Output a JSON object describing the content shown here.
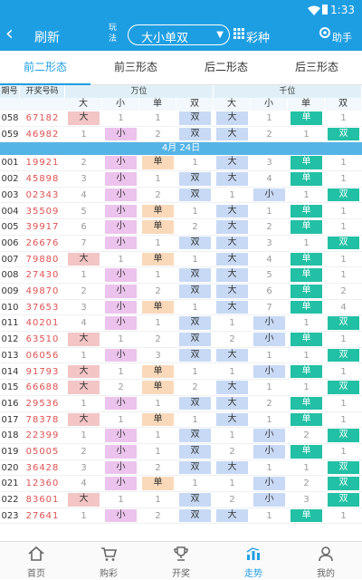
{
  "status_bar": {
    "time": "1:33"
  },
  "header": {
    "refresh_label": "刷新",
    "play_label": "玩法",
    "play_value": "大小单双",
    "lottery_label": "彩种",
    "help_label": "助手"
  },
  "tabs": [
    {
      "label": "前二形态",
      "active": true
    },
    {
      "label": "前三形态",
      "active": false
    },
    {
      "label": "后二形态",
      "active": false
    },
    {
      "label": "后三形态",
      "active": false
    }
  ],
  "table": {
    "col_issue": "期号",
    "col_number": "开奖号码",
    "group1": "万位",
    "group2": "千位",
    "subheaders": [
      "大",
      "小",
      "单",
      "双",
      "大",
      "小",
      "单",
      "双"
    ],
    "date_label": "4月 24日",
    "pre_rows": [
      {
        "issue": "058",
        "number": "67182",
        "cells": [
          "大",
          "1",
          "1",
          "双",
          "大",
          "1",
          "单",
          "1"
        ]
      },
      {
        "issue": "059",
        "number": "46982",
        "cells": [
          "1",
          "小",
          "2",
          "双",
          "大",
          "2",
          "1",
          "双"
        ]
      }
    ],
    "rows": [
      {
        "issue": "001",
        "number": "19921",
        "cells": [
          "2",
          "小",
          "单",
          "1",
          "大",
          "3",
          "单",
          "1"
        ]
      },
      {
        "issue": "002",
        "number": "45898",
        "cells": [
          "3",
          "小",
          "1",
          "双",
          "大",
          "4",
          "单",
          "1"
        ]
      },
      {
        "issue": "003",
        "number": "02343",
        "cells": [
          "4",
          "小",
          "2",
          "双",
          "1",
          "小",
          "1",
          "双"
        ]
      },
      {
        "issue": "004",
        "number": "35509",
        "cells": [
          "5",
          "小",
          "单",
          "1",
          "大",
          "1",
          "单",
          "1"
        ]
      },
      {
        "issue": "005",
        "number": "39917",
        "cells": [
          "6",
          "小",
          "单",
          "2",
          "大",
          "2",
          "单",
          "1"
        ]
      },
      {
        "issue": "006",
        "number": "26676",
        "cells": [
          "7",
          "小",
          "1",
          "双",
          "大",
          "3",
          "1",
          "双"
        ]
      },
      {
        "issue": "007",
        "number": "79880",
        "cells": [
          "大",
          "1",
          "单",
          "1",
          "大",
          "4",
          "单",
          "1"
        ]
      },
      {
        "issue": "008",
        "number": "27430",
        "cells": [
          "1",
          "小",
          "1",
          "双",
          "大",
          "5",
          "单",
          "1"
        ]
      },
      {
        "issue": "009",
        "number": "49870",
        "cells": [
          "2",
          "小",
          "2",
          "双",
          "大",
          "6",
          "单",
          "2"
        ]
      },
      {
        "issue": "010",
        "number": "37653",
        "cells": [
          "3",
          "小",
          "单",
          "1",
          "大",
          "7",
          "单",
          "4"
        ]
      },
      {
        "issue": "011",
        "number": "40201",
        "cells": [
          "4",
          "小",
          "1",
          "双",
          "1",
          "小",
          "1",
          "双"
        ]
      },
      {
        "issue": "012",
        "number": "63510",
        "cells": [
          "大",
          "1",
          "2",
          "双",
          "2",
          "小",
          "单",
          "1"
        ]
      },
      {
        "issue": "013",
        "number": "06056",
        "cells": [
          "1",
          "小",
          "3",
          "双",
          "大",
          "1",
          "1",
          "双"
        ]
      },
      {
        "issue": "014",
        "number": "91793",
        "cells": [
          "大",
          "1",
          "单",
          "1",
          "1",
          "小",
          "单",
          "1"
        ]
      },
      {
        "issue": "015",
        "number": "66688",
        "cells": [
          "大",
          "2",
          "单",
          "2",
          "大",
          "1",
          "1",
          "双"
        ]
      },
      {
        "issue": "016",
        "number": "29536",
        "cells": [
          "1",
          "小",
          "1",
          "双",
          "大",
          "2",
          "单",
          "1"
        ]
      },
      {
        "issue": "017",
        "number": "78378",
        "cells": [
          "大",
          "1",
          "单",
          "1",
          "大",
          "1",
          "单",
          "1"
        ]
      },
      {
        "issue": "018",
        "number": "22399",
        "cells": [
          "1",
          "小",
          "1",
          "双",
          "1",
          "小",
          "2",
          "双"
        ]
      },
      {
        "issue": "019",
        "number": "05005",
        "cells": [
          "2",
          "小",
          "1",
          "双",
          "2",
          "小",
          "单",
          "1"
        ]
      },
      {
        "issue": "020",
        "number": "36428",
        "cells": [
          "3",
          "小",
          "2",
          "双",
          "大",
          "1",
          "1",
          "双"
        ]
      },
      {
        "issue": "021",
        "number": "12360",
        "cells": [
          "4",
          "小",
          "单",
          "1",
          "1",
          "小",
          "2",
          "双"
        ]
      },
      {
        "issue": "022",
        "number": "83601",
        "cells": [
          "大",
          "1",
          "1",
          "双",
          "2",
          "小",
          "3",
          "双"
        ]
      },
      {
        "issue": "023",
        "number": "27641",
        "cells": [
          "1",
          "小",
          "2",
          "双",
          "大",
          "1",
          "单",
          "1"
        ]
      }
    ]
  },
  "bottom_nav": [
    {
      "label": "首页",
      "icon": "home-icon",
      "active": false
    },
    {
      "label": "购彩",
      "icon": "cart-icon",
      "active": false
    },
    {
      "label": "开奖",
      "icon": "trophy-icon",
      "active": false
    },
    {
      "label": "走势",
      "icon": "trend-chart-icon",
      "active": true
    },
    {
      "label": "我的",
      "icon": "user-icon",
      "active": false
    }
  ],
  "colors": {
    "primary": "#1e9ee2",
    "big": "#f3c5c5",
    "small": "#ecc3ec",
    "odd": "#f9d9ba",
    "even": "#c7d9f4",
    "highlight": "#22c0a5"
  }
}
